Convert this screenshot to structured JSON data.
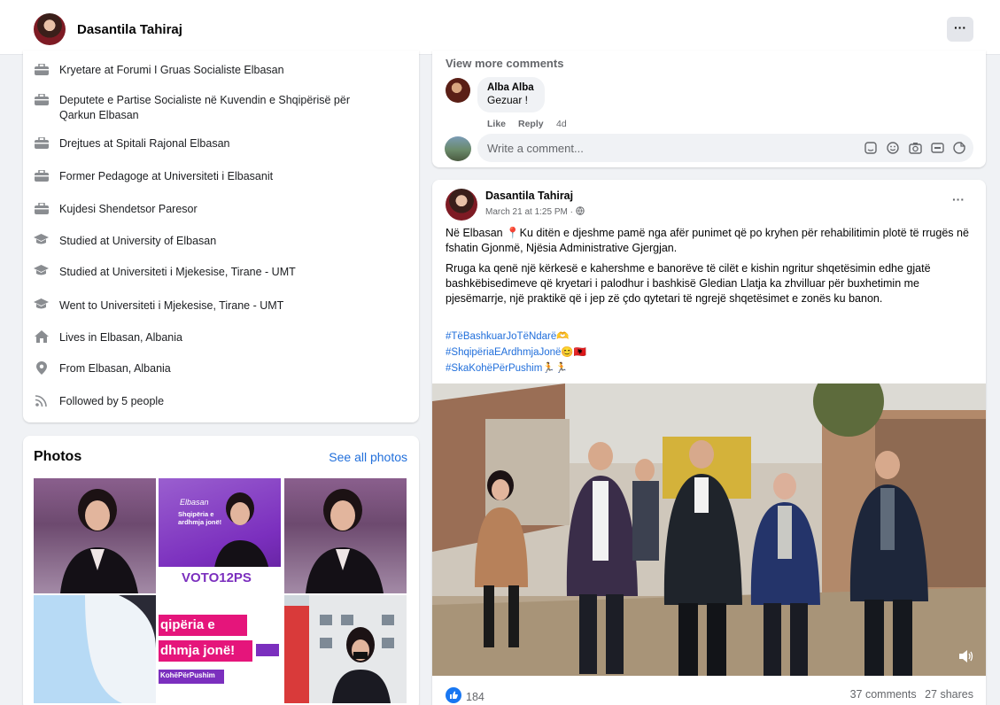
{
  "header": {
    "name": "Dasantila Tahiraj",
    "more": "···"
  },
  "intro": {
    "items": [
      {
        "icon": "briefcase-icon",
        "text": "Kryetare at Forumi I Gruas Socialiste Elbasan"
      },
      {
        "icon": "briefcase-icon",
        "text": "Deputete e Partise Socialiste në Kuvendin e Shqipërisë për Qarkun Elbasan"
      },
      {
        "icon": "briefcase-icon",
        "text": "Drejtues at Spitali Rajonal Elbasan"
      },
      {
        "icon": "briefcase-icon",
        "text": "Former Pedagoge at Universiteti i Elbasanit"
      },
      {
        "icon": "briefcase-icon",
        "text": "Kujdesi Shendetsor Paresor"
      },
      {
        "icon": "graduation-cap-icon",
        "text": "Studied at University of Elbasan"
      },
      {
        "icon": "graduation-cap-icon",
        "text": "Studied at Universiteti i Mjekesise, Tirane - UMT"
      },
      {
        "icon": "graduation-cap-icon",
        "text": "Went to Universiteti i Mjekesise, Tirane - UMT"
      },
      {
        "icon": "home-icon",
        "text": "Lives in Elbasan, Albania"
      },
      {
        "icon": "location-pin-icon",
        "text": "From Elbasan, Albania"
      },
      {
        "icon": "rss-icon",
        "text": "Followed by 5 people"
      }
    ]
  },
  "photos": {
    "title": "Photos",
    "see_all": "See all photos",
    "tiles": [
      {
        "overlay_top": "",
        "overlay_mid": "",
        "overlay_bottom": ""
      },
      {
        "overlay_top": "Shqipëria e ardhmja jonë!",
        "overlay_mid": "Elbasan",
        "overlay_bottom": "VOTO12PS"
      },
      {
        "overlay_top": "",
        "overlay_mid": "",
        "overlay_bottom": ""
      },
      {
        "overlay_top": "",
        "overlay_mid": "",
        "overlay_bottom": ""
      },
      {
        "overlay_top": "qipëria e",
        "overlay_mid": "dhmja jonë!",
        "overlay_bottom": "KohëPërPushim"
      },
      {
        "overlay_top": "",
        "overlay_mid": "",
        "overlay_bottom": ""
      }
    ]
  },
  "comments": {
    "view_more": "View more comments",
    "comment": {
      "author": "Alba Alba",
      "text": "Gezuar !",
      "like": "Like",
      "reply": "Reply",
      "time": "4d"
    },
    "write_placeholder": "Write a comment..."
  },
  "post": {
    "author": "Dasantila Tahiraj",
    "timestamp": "March 21 at 1:25 PM ·",
    "more": "···",
    "paragraph1": "Në Elbasan 📍Ku ditën e djeshme pamë nga afër punimet që po kryhen për rehabilitimin plotë të rrugës në fshatin Gjonmë, Njësia Administrative Gjergjan.",
    "paragraph2": "Rruga ka qenë një kërkesë e kahershme e banorëve të cilët e kishin ngritur shqetësimin edhe gjatë bashkëbisedimeve që kryetari i palodhur i bashkisë Gledian Llatja ka zhvilluar për buxhetimin me pjesëmarrje, një praktikë që i jep zë çdo qytetari të ngrejë shqetësimet e zonës ku banon.",
    "hashtags": [
      "#TëBashkuarJoTëNdarë🫶",
      "#ShqipëriaEArdhmjaJonë😊🇦🇱",
      "#SkaKohëPërPushim🏃🏃"
    ],
    "likes": "184",
    "comments_count": "37 comments",
    "shares": "27 shares"
  },
  "colors": {
    "link": "#216fdb",
    "brand_purple": "#7b2fbe",
    "background": "#f0f2f5"
  }
}
